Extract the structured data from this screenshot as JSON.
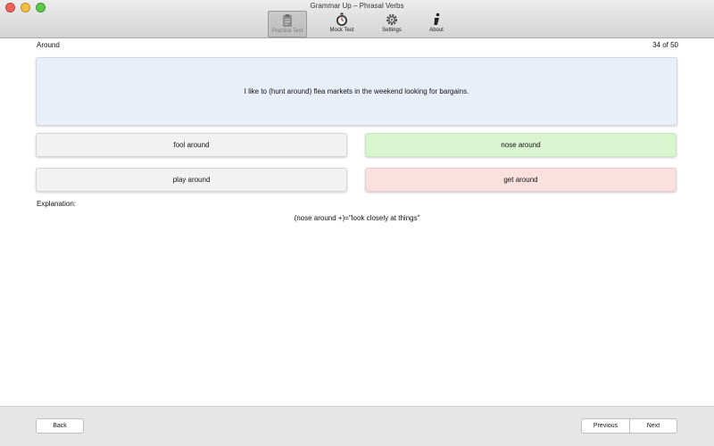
{
  "window": {
    "title": "Grammar Up – Phrasal Verbs"
  },
  "toolbar": {
    "items": [
      {
        "label": "Practice Test",
        "icon": "clipboard-icon",
        "selected": true
      },
      {
        "label": "Mock Test",
        "icon": "stopwatch-icon",
        "selected": false
      },
      {
        "label": "Settings",
        "icon": "gear-icon",
        "selected": false
      },
      {
        "label": "About",
        "icon": "info-icon",
        "selected": false
      }
    ]
  },
  "question": {
    "category": "Around",
    "progress": "34 of 50",
    "text": "I like to (hunt around) flea markets in the weekend looking for bargains."
  },
  "answers": [
    {
      "label": "fool around",
      "state": "neutral"
    },
    {
      "label": "nose around",
      "state": "correct"
    },
    {
      "label": "play around",
      "state": "neutral"
    },
    {
      "label": "get around",
      "state": "wrong"
    }
  ],
  "explanation": {
    "label": "Explanation:",
    "text": "(nose around +)=\"look closely at things\""
  },
  "footer": {
    "back_label": "Back",
    "previous_label": "Previous",
    "next_label": "Next"
  },
  "colors": {
    "correct": "#d9f5cf",
    "wrong": "#fbe0e0",
    "question_bg": "#e9eff8"
  }
}
